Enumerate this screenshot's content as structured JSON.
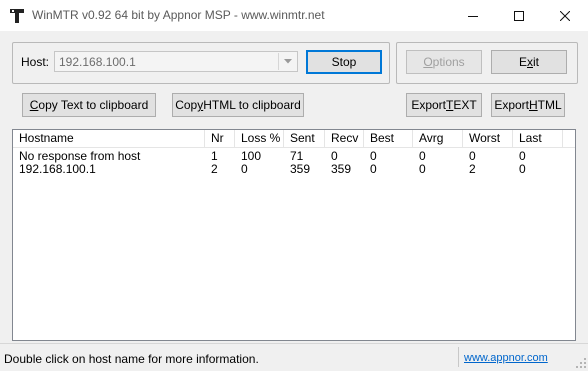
{
  "window": {
    "title": "WinMTR v0.92 64 bit by Appnor MSP - www.winmtr.net"
  },
  "host": {
    "label": "Host:",
    "value": "192.168.100.1"
  },
  "buttons": {
    "stop": "Stop",
    "options": "Options",
    "exit": "Exit",
    "copy_text": "Copy Text to clipboard",
    "copy_html": "Copy HTML to clipboard",
    "export_text": "Export TEXT",
    "export_html": "Export HTML"
  },
  "table": {
    "columns": [
      "Hostname",
      "Nr",
      "Loss %",
      "Sent",
      "Recv",
      "Best",
      "Avrg",
      "Worst",
      "Last"
    ],
    "rows": [
      [
        "No response from host",
        "1",
        "100",
        "71",
        "0",
        "0",
        "0",
        "0",
        "0"
      ],
      [
        "192.168.100.1",
        "2",
        "0",
        "359",
        "359",
        "0",
        "0",
        "2",
        "0"
      ]
    ]
  },
  "statusbar": {
    "text": "Double click on host name for more information.",
    "link": "www.appnor.com"
  },
  "colors": {
    "link": "#0066cc",
    "focus_border": "#0078d7"
  }
}
